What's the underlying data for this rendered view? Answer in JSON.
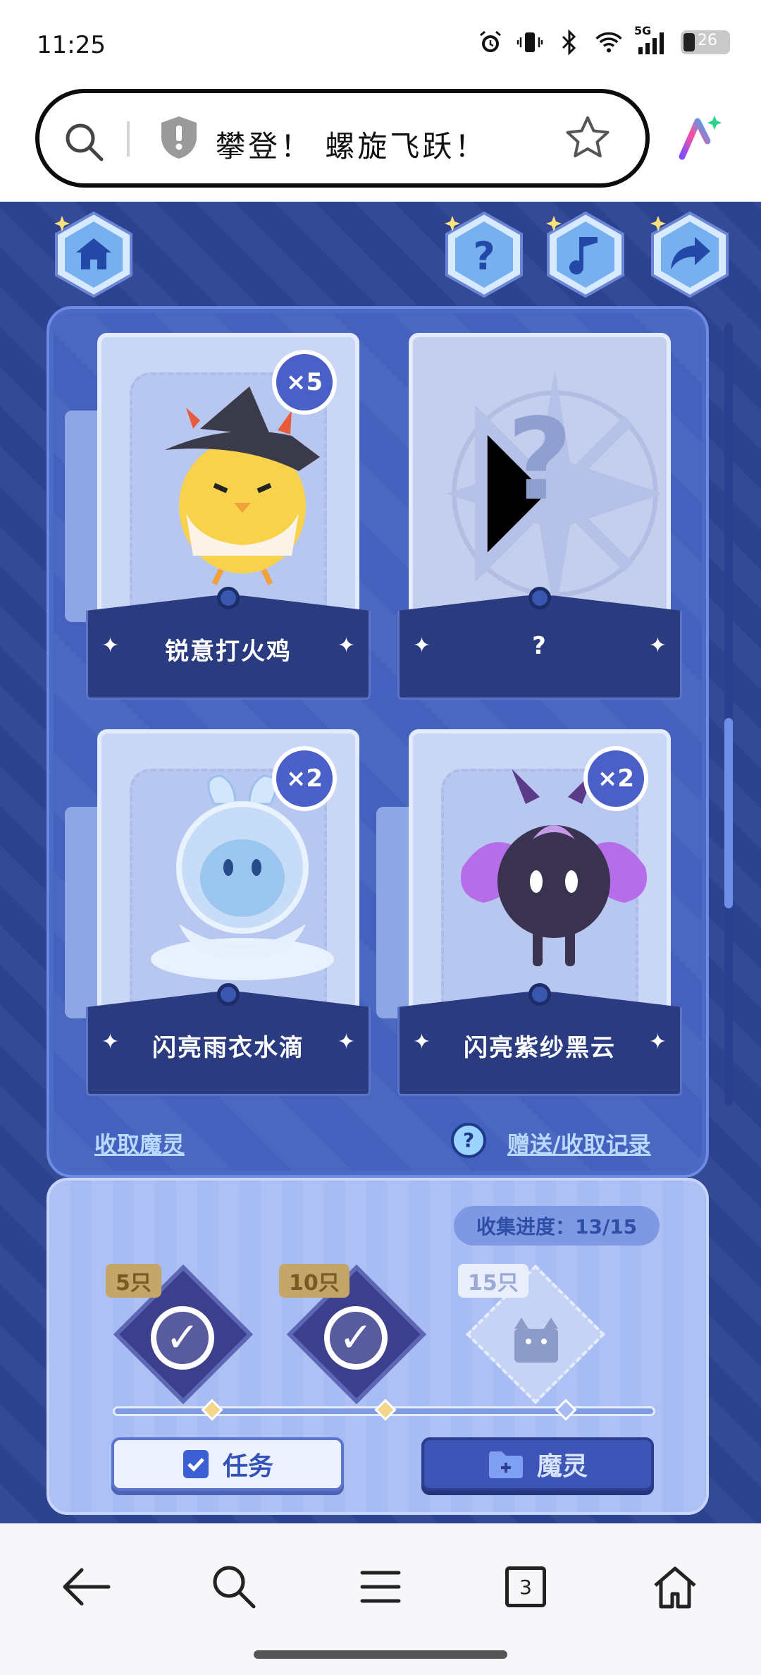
{
  "status": {
    "time": "11:25",
    "network": "5G",
    "battery": "26"
  },
  "browser": {
    "title": "攀登！ 螺旋飞跃！",
    "icons": [
      "search-icon",
      "shield-icon",
      "star-icon",
      "ai-assistant-icon"
    ]
  },
  "game": {
    "cards": [
      {
        "name": "锐意打火鸡",
        "count": "×5",
        "revealed": true
      },
      {
        "name": "?",
        "count": "",
        "revealed": false
      },
      {
        "name": "闪亮雨衣水滴",
        "count": "×2",
        "revealed": true
      },
      {
        "name": "闪亮紫纱黑云",
        "count": "×2",
        "revealed": true
      }
    ],
    "collect_link": "收取魔灵",
    "record_link": "赠送/收取记录",
    "progress_label": "收集进度：13/15",
    "milestones": [
      {
        "label": "5只",
        "completed": true
      },
      {
        "label": "10只",
        "completed": true
      },
      {
        "label": "15只",
        "completed": false
      }
    ],
    "task_button": "任务",
    "spirit_button": "魔灵",
    "colors": {
      "accent": "#4b6ac6",
      "background": "#2e4494"
    }
  },
  "nav": {
    "tabs_count": "3"
  }
}
